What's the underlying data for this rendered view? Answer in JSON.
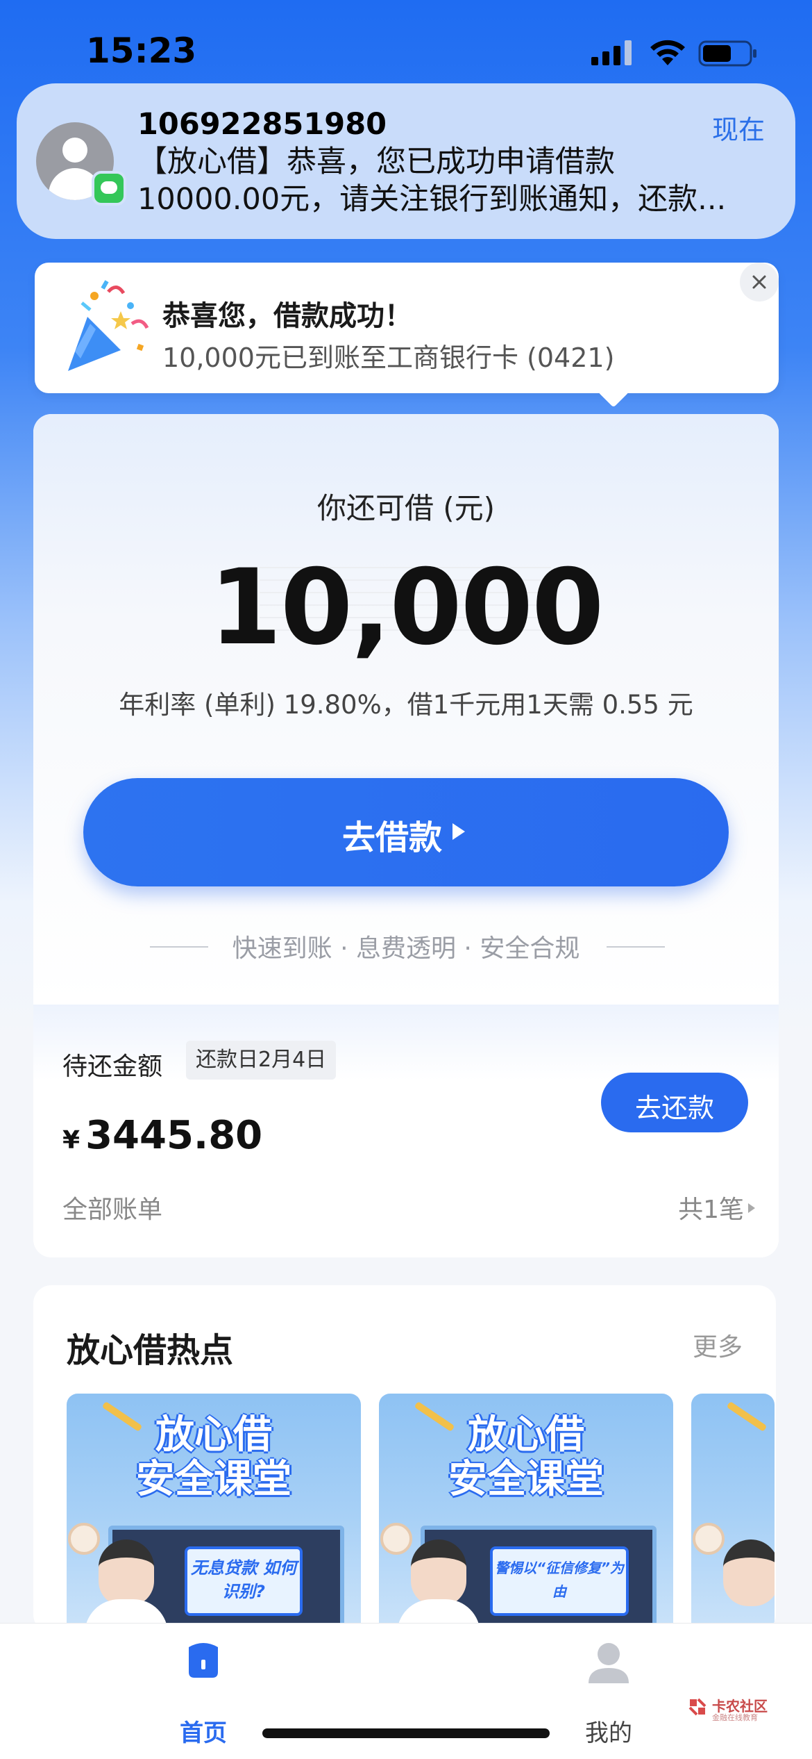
{
  "status_bar": {
    "time": "15:23"
  },
  "notification": {
    "sender": "106922851980",
    "time": "现在",
    "line1": "【放心借】恭喜，您已成功申请借款",
    "line2": "10000.00元，请关注银行到账通知，还款..."
  },
  "toast": {
    "title": "恭喜您，借款成功！",
    "subtitle": "10,000元已到账至工商银行卡 (0421)"
  },
  "loan": {
    "available_label": "你还可借 (元)",
    "available_amount": "10,000",
    "rate_text": "年利率 (单利) 19.80%，借1千元用1天需 0.55 元",
    "borrow_button": "去借款",
    "slogan": "快速到账 · 息费透明 · 安全合规"
  },
  "repayment": {
    "label": "待还金额",
    "due_date": "还款日2月4日",
    "currency": "¥",
    "amount": "3445.80",
    "repay_button": "去还款",
    "all_bills": "全部账单",
    "bill_count": "共1笔"
  },
  "hot": {
    "title": "放心借热点",
    "more": "更多",
    "items": [
      {
        "title1": "放心借",
        "title2": "安全课堂",
        "board_text": "无息贷款 如何识别?"
      },
      {
        "title1": "放心借",
        "title2": "安全课堂",
        "board_text": "警惕以“征信修复”为由"
      }
    ]
  },
  "tab_bar": {
    "home": "首页",
    "mine": "我的"
  },
  "watermark": {
    "name": "卡农社区",
    "tagline": "金融在线教育"
  },
  "colors": {
    "accent": "#2a6bef",
    "banner": "#1f6cf2"
  }
}
